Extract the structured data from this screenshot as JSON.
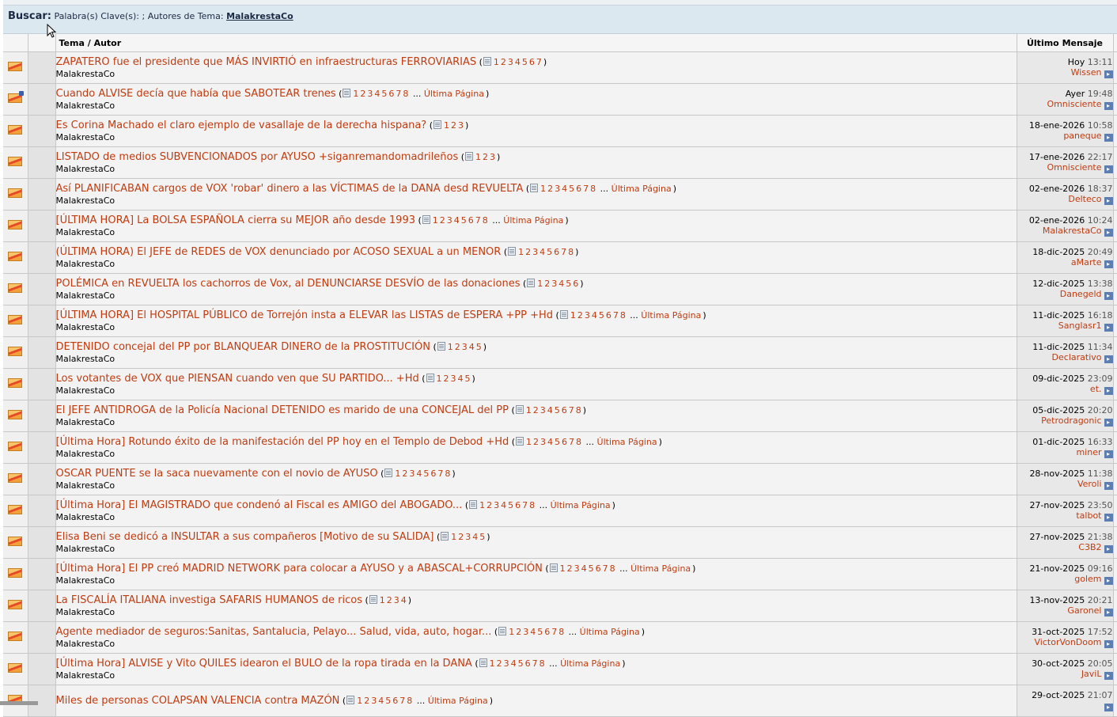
{
  "search": {
    "label": "Buscar:",
    "keywords_text": "Palabra(s) Clave(s): ; Autores de Tema:",
    "author": "MalakrestaCo"
  },
  "columns": {
    "topic_author": "Tema / Autor",
    "last_post": "Último Mensaje"
  },
  "last_page_label": "Última Página",
  "colors": {
    "link": "#c03c10",
    "header_bg": "#dce8f0"
  },
  "topics": [
    {
      "title": "ZAPATERO fue el presidente que MÁS INVIRTIÓ en infraestructuras FERROVIARIAS",
      "pages": [
        "1",
        "2",
        "3",
        "4",
        "5",
        "6",
        "7"
      ],
      "last_page": false,
      "author": "MalakrestaCo",
      "date": "Hoy",
      "time": "13:11",
      "user": "Wissen",
      "icon": "envelope-icon"
    },
    {
      "title": "Cuando ALVISE decía que había que SABOTEAR trenes",
      "pages": [
        "1",
        "2",
        "3",
        "4",
        "5",
        "6",
        "7",
        "8"
      ],
      "last_page": true,
      "author": "MalakrestaCo",
      "date": "Ayer",
      "time": "19:48",
      "user": "Omnisciente",
      "icon": "hot-envelope-icon"
    },
    {
      "title": "Es Corina Machado el claro ejemplo de vasallaje de la derecha hispana?",
      "pages": [
        "1",
        "2",
        "3"
      ],
      "last_page": false,
      "author": "MalakrestaCo",
      "date": "18-ene-2026",
      "time": "10:58",
      "user": "paneque",
      "icon": "envelope-icon"
    },
    {
      "title": "LISTADO de medios SUBVENCIONADOS por AYUSO +siganremandomadrileños",
      "pages": [
        "1",
        "2",
        "3"
      ],
      "last_page": false,
      "author": "MalakrestaCo",
      "date": "17-ene-2026",
      "time": "22:17",
      "user": "Omnisciente",
      "icon": "envelope-icon"
    },
    {
      "title": "Así PLANIFICABAN cargos de VOX 'robar' dinero a las VÍCTIMAS de la DANA desd REVUELTA",
      "pages": [
        "1",
        "2",
        "3",
        "4",
        "5",
        "6",
        "7",
        "8"
      ],
      "last_page": true,
      "author": "MalakrestaCo",
      "date": "02-ene-2026",
      "time": "18:37",
      "user": "Delteco",
      "icon": "envelope-icon"
    },
    {
      "title": "[ÚLTIMA HORA] La BOLSA ESPAÑOLA cierra su MEJOR año desde 1993",
      "pages": [
        "1",
        "2",
        "3",
        "4",
        "5",
        "6",
        "7",
        "8"
      ],
      "last_page": true,
      "author": "MalakrestaCo",
      "date": "02-ene-2026",
      "time": "10:24",
      "user": "MalakrestaCo",
      "icon": "envelope-icon"
    },
    {
      "title": "(ÚLTIMA HORA) El JEFE de REDES de VOX denunciado por ACOSO SEXUAL a un MENOR",
      "pages": [
        "1",
        "2",
        "3",
        "4",
        "5",
        "6",
        "7",
        "8"
      ],
      "last_page": false,
      "author": "MalakrestaCo",
      "date": "18-dic-2025",
      "time": "20:49",
      "user": "aMarte",
      "icon": "envelope-icon"
    },
    {
      "title": "POLÉMICA en REVUELTA los cachorros de Vox, al DENUNCIARSE DESVÍO de las donaciones",
      "pages": [
        "1",
        "2",
        "3",
        "4",
        "5",
        "6"
      ],
      "last_page": false,
      "author": "MalakrestaCo",
      "date": "12-dic-2025",
      "time": "13:38",
      "user": "Danegeld",
      "icon": "envelope-icon"
    },
    {
      "title": "[ÚLTIMA HORA] El HOSPITAL PÚBLICO de Torrejón insta a ELEVAR las LISTAS de ESPERA +PP +Hd",
      "pages": [
        "1",
        "2",
        "3",
        "4",
        "5",
        "6",
        "7",
        "8"
      ],
      "last_page": true,
      "author": "MalakrestaCo",
      "date": "11-dic-2025",
      "time": "16:18",
      "user": "Sanglasr1",
      "icon": "envelope-icon"
    },
    {
      "title": "DETENIDO concejal del PP por BLANQUEAR DINERO de la PROSTITUCIÓN",
      "pages": [
        "1",
        "2",
        "3",
        "4",
        "5"
      ],
      "last_page": false,
      "author": "MalakrestaCo",
      "date": "11-dic-2025",
      "time": "11:34",
      "user": "Declarativo",
      "icon": "envelope-icon"
    },
    {
      "title": "Los votantes de VOX que PIENSAN cuando ven que SU PARTIDO... +Hd",
      "pages": [
        "1",
        "2",
        "3",
        "4",
        "5"
      ],
      "last_page": false,
      "author": "MalakrestaCo",
      "date": "09-dic-2025",
      "time": "23:09",
      "user": "et.",
      "icon": "envelope-icon"
    },
    {
      "title": "El JEFE ANTIDROGA de la Policía Nacional DETENIDO es marido de una CONCEJAL del PP",
      "pages": [
        "1",
        "2",
        "3",
        "4",
        "5",
        "6",
        "7",
        "8"
      ],
      "last_page": false,
      "author": "MalakrestaCo",
      "date": "05-dic-2025",
      "time": "20:20",
      "user": "Petrodragonic",
      "icon": "envelope-icon"
    },
    {
      "title": "[Última Hora] Rotundo éxito de la manifestación del PP hoy en el Templo de Debod +Hd",
      "pages": [
        "1",
        "2",
        "3",
        "4",
        "5",
        "6",
        "7",
        "8"
      ],
      "last_page": true,
      "author": "MalakrestaCo",
      "date": "01-dic-2025",
      "time": "16:33",
      "user": "miner",
      "icon": "envelope-icon"
    },
    {
      "title": "OSCAR PUENTE se la saca nuevamente con el novio de AYUSO",
      "pages": [
        "1",
        "2",
        "3",
        "4",
        "5",
        "6",
        "7",
        "8"
      ],
      "last_page": false,
      "author": "MalakrestaCo",
      "date": "28-nov-2025",
      "time": "11:38",
      "user": "Veroli",
      "icon": "envelope-icon"
    },
    {
      "title": "[Última Hora] El MAGISTRADO que condenó al Fiscal es AMIGO del ABOGADO...",
      "pages": [
        "1",
        "2",
        "3",
        "4",
        "5",
        "6",
        "7",
        "8"
      ],
      "last_page": true,
      "author": "MalakrestaCo",
      "date": "27-nov-2025",
      "time": "23:50",
      "user": "talbot",
      "icon": "envelope-icon"
    },
    {
      "title": "Elisa Beni se dedicó a INSULTAR a sus compañeros [Motivo de su SALIDA]",
      "pages": [
        "1",
        "2",
        "3",
        "4",
        "5"
      ],
      "last_page": false,
      "author": "MalakrestaCo",
      "date": "27-nov-2025",
      "time": "21:38",
      "user": "C3B2",
      "icon": "envelope-icon"
    },
    {
      "title": "[Última Hora] El PP creó MADRID NETWORK para colocar a AYUSO y a ABASCAL+CORRUPCIÓN",
      "pages": [
        "1",
        "2",
        "3",
        "4",
        "5",
        "6",
        "7",
        "8"
      ],
      "last_page": true,
      "author": "MalakrestaCo",
      "date": "21-nov-2025",
      "time": "09:16",
      "user": "golem",
      "icon": "envelope-icon"
    },
    {
      "title": "La FISCALÍA ITALIANA investiga SAFARIS HUMANOS de ricos",
      "pages": [
        "1",
        "2",
        "3",
        "4"
      ],
      "last_page": false,
      "author": "MalakrestaCo",
      "date": "13-nov-2025",
      "time": "20:21",
      "user": "Garonel",
      "icon": "envelope-icon"
    },
    {
      "title": "Agente mediador de seguros:Sanitas, Santalucia, Pelayo... Salud, vida, auto, hogar...",
      "pages": [
        "1",
        "2",
        "3",
        "4",
        "5",
        "6",
        "7",
        "8"
      ],
      "last_page": true,
      "author": "MalakrestaCo",
      "date": "31-oct-2025",
      "time": "17:52",
      "user": "VictorVonDoom",
      "icon": "envelope-icon"
    },
    {
      "title": "[Última Hora] ALVISE y Vito QUILES idearon el BULO de la ropa tirada en la DANA",
      "pages": [
        "1",
        "2",
        "3",
        "4",
        "5",
        "6",
        "7",
        "8"
      ],
      "last_page": true,
      "author": "MalakrestaCo",
      "date": "30-oct-2025",
      "time": "20:05",
      "user": "JaviL",
      "icon": "envelope-icon"
    },
    {
      "title": "Miles de personas COLAPSAN VALENCIA contra MAZÓN",
      "pages": [
        "1",
        "2",
        "3",
        "4",
        "5",
        "6",
        "7",
        "8"
      ],
      "last_page": true,
      "author": "",
      "date": "29-oct-2025",
      "time": "21:07",
      "user": "",
      "icon": "envelope-icon"
    }
  ]
}
